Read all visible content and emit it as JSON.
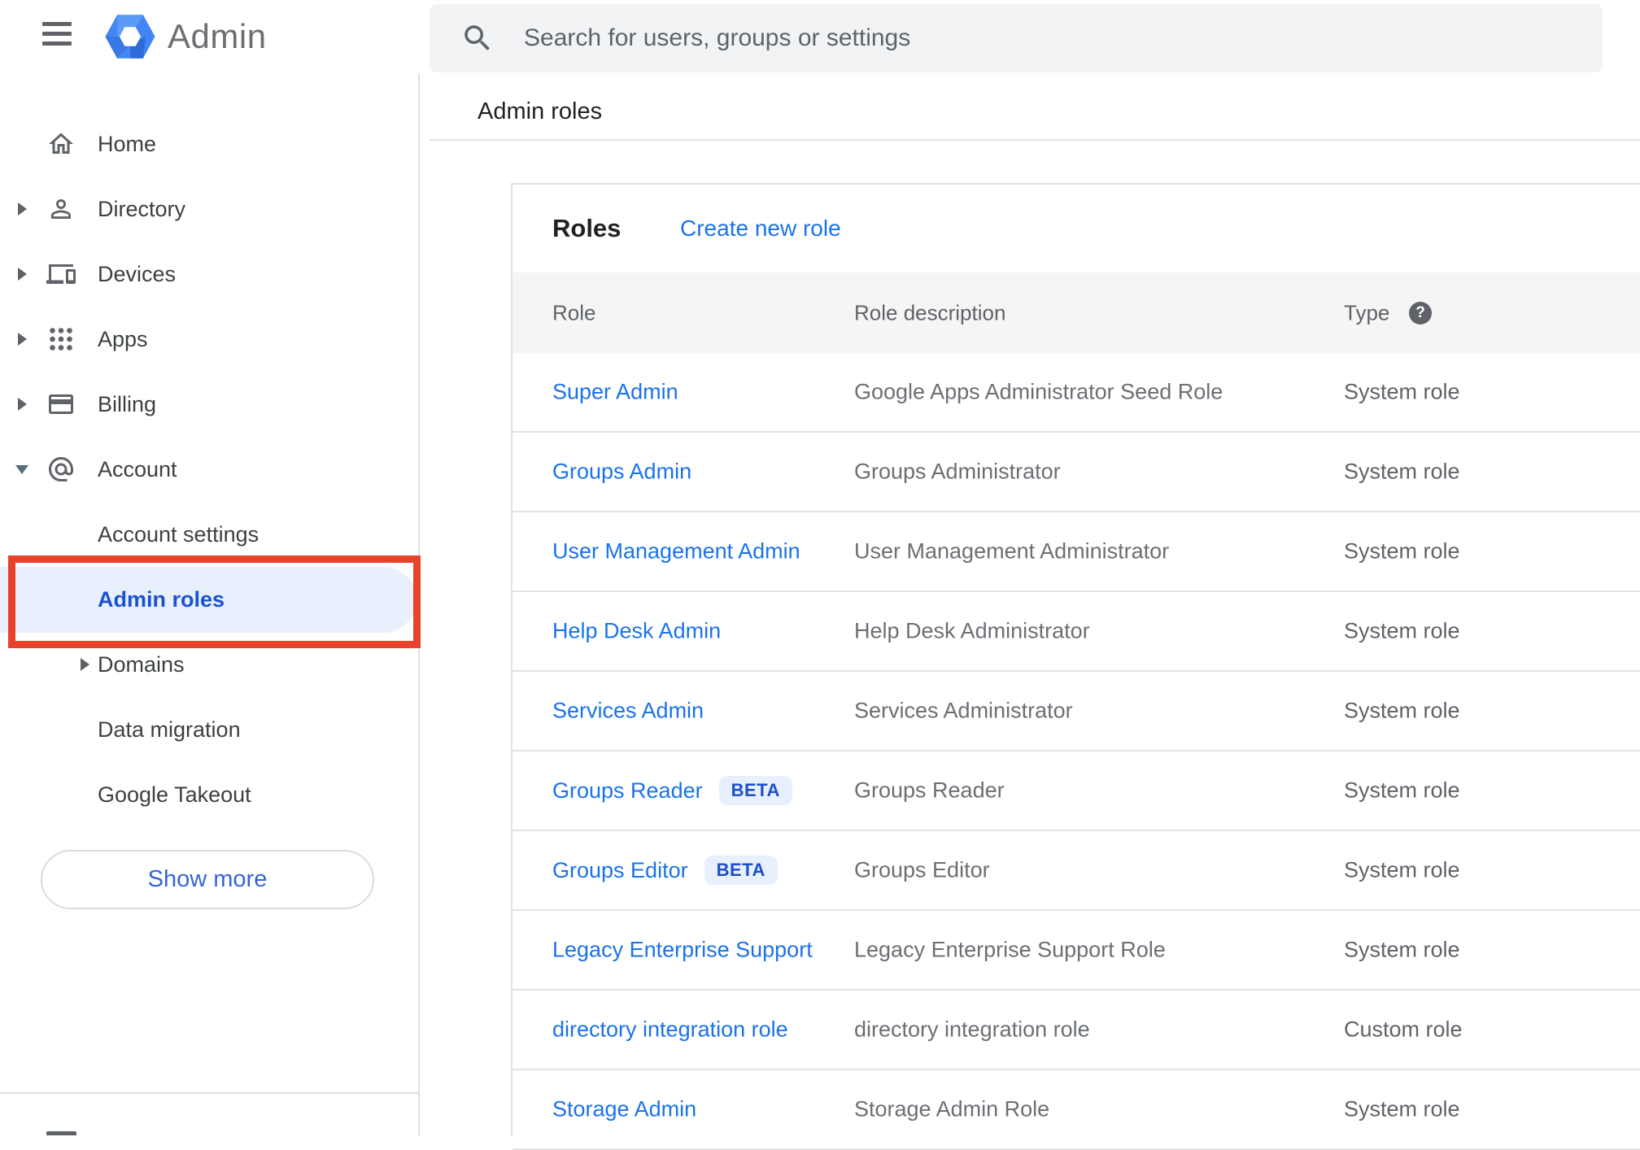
{
  "app": {
    "name": "Admin"
  },
  "search": {
    "placeholder": "Search for users, groups or settings"
  },
  "breadcrumb": "Admin roles",
  "sidebar": {
    "items": [
      {
        "label": "Home"
      },
      {
        "label": "Directory"
      },
      {
        "label": "Devices"
      },
      {
        "label": "Apps"
      },
      {
        "label": "Billing"
      },
      {
        "label": "Account"
      },
      {
        "label": "Account settings"
      },
      {
        "label": "Admin roles",
        "active": true,
        "annotated": true
      },
      {
        "label": "Domains"
      },
      {
        "label": "Data migration"
      },
      {
        "label": "Google Takeout"
      }
    ],
    "show_more_label": "Show more"
  },
  "main": {
    "card_title": "Roles",
    "create_link": "Create new role",
    "table": {
      "columns": [
        "Role",
        "Role description",
        "Type"
      ],
      "help_glyph": "?",
      "rows": [
        {
          "role": "Super Admin",
          "description": "Google Apps Administrator Seed Role",
          "type": "System role"
        },
        {
          "role": "Groups Admin",
          "description": "Groups Administrator",
          "type": "System role"
        },
        {
          "role": "User Management Admin",
          "description": "User Management Administrator",
          "type": "System role"
        },
        {
          "role": "Help Desk Admin",
          "description": "Help Desk Administrator",
          "type": "System role"
        },
        {
          "role": "Services Admin",
          "description": "Services Administrator",
          "type": "System role"
        },
        {
          "role": "Groups Reader",
          "badge": "BETA",
          "description": "Groups Reader",
          "type": "System role"
        },
        {
          "role": "Groups Editor",
          "badge": "BETA",
          "description": "Groups Editor",
          "type": "System role"
        },
        {
          "role": "Legacy Enterprise Support",
          "description": "Legacy Enterprise Support Role",
          "type": "System role"
        },
        {
          "role": "directory integration role",
          "description": "directory integration role",
          "type": "Custom role"
        },
        {
          "role": "Storage Admin",
          "description": "Storage Admin Role",
          "type": "System role"
        }
      ]
    }
  },
  "colors": {
    "link_blue": "#1a73e8",
    "active_blue": "#1b53cd",
    "active_bg": "#e8f0fe",
    "annotation_red": "#e8422c",
    "beta_bg": "#e8f0fe",
    "beta_text": "#1b50c9",
    "search_bg": "#f1f3f4",
    "table_head_bg": "#f5f5f5",
    "logo_blue": "#4285f4"
  }
}
